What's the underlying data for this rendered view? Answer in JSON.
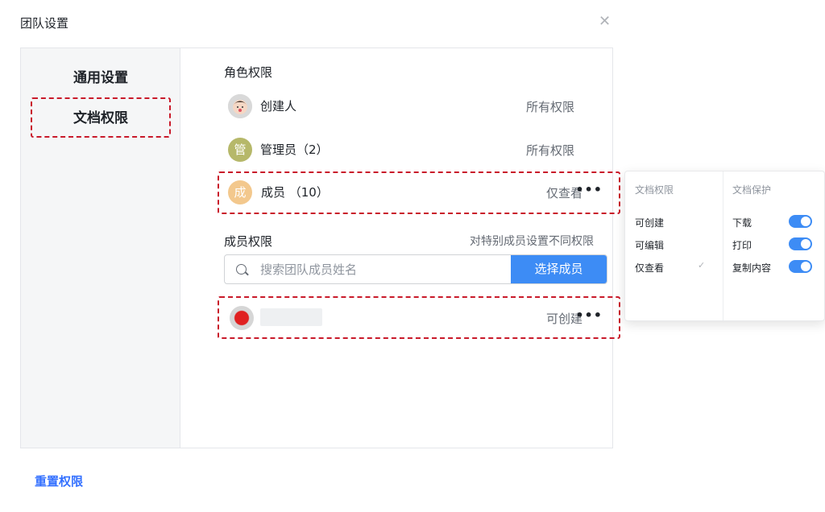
{
  "dialog": {
    "title": "团队设置",
    "close_icon": "close-icon"
  },
  "nav": {
    "general": "通用设置",
    "doc_permissions": "文档权限"
  },
  "roles": {
    "title": "角色权限",
    "items": [
      {
        "avatar_icon": "creator-avatar",
        "avatar_text": "",
        "avatar_color": "#e0e0e0",
        "name": "创建人",
        "permission": "所有权限"
      },
      {
        "avatar_icon": "admin-avatar",
        "avatar_text": "管",
        "avatar_color": "#b6b86a",
        "name": "管理员（2）",
        "permission": "所有权限"
      },
      {
        "avatar_icon": "member-avatar",
        "avatar_text": "成",
        "avatar_color": "#f3c88d",
        "name": "成员 （10）",
        "permission": "仅查看"
      }
    ]
  },
  "members": {
    "title": "成员权限",
    "hint": "对特别成员设置不同权限",
    "search_placeholder": "搜索团队成员姓名",
    "select_button": "选择成员",
    "items": [
      {
        "permission": "可创建"
      }
    ]
  },
  "reset_link": "重置权限",
  "popover": {
    "doc_permission": {
      "title": "文档权限",
      "options": [
        "可创建",
        "可编辑",
        "仅查看"
      ],
      "selected": "仅查看"
    },
    "doc_protection": {
      "title": "文档保护",
      "options": [
        {
          "label": "下载",
          "enabled": true
        },
        {
          "label": "打印",
          "enabled": true
        },
        {
          "label": "复制内容",
          "enabled": true
        }
      ]
    }
  },
  "colors": {
    "accent": "#3d8cf5",
    "link": "#3370ff",
    "highlight_border": "#c91a2a"
  }
}
